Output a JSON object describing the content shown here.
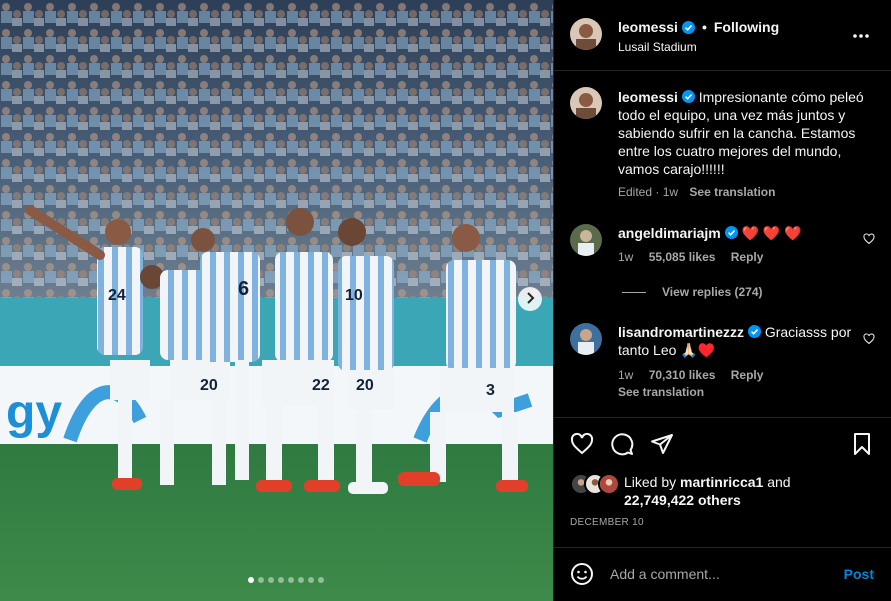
{
  "post": {
    "author": "leomessi",
    "follow_state": "Following",
    "separator": "•",
    "location": "Lusail Stadium",
    "more_icon": "more-horizontal-icon",
    "date": "DECEMBER 10"
  },
  "caption": {
    "username": "leomessi",
    "text": "Impresionante cómo peleó todo el equipo, una vez más juntos y sabiendo sufrir en la cancha. Estamos entre los cuatro mejores del mundo, vamos carajo!!!!!!",
    "edited": "Edited",
    "dot": "·",
    "age": "1w",
    "see_translation": "See translation"
  },
  "comments": [
    {
      "username": "angeldimariajm",
      "text": "❤️ ❤️ ❤️",
      "age": "1w",
      "likes": "55,085 likes",
      "reply": "Reply",
      "view_replies": "View replies (274)"
    },
    {
      "username": "lisandromartinezzz",
      "text": "Graciasss por tanto Leo 🙏🏻♥️",
      "age": "1w",
      "likes": "70,310 likes",
      "reply": "Reply",
      "see_translation": "See translation"
    }
  ],
  "likes": {
    "prefix": "Liked by",
    "user": "martinricca1",
    "and": "and",
    "others": "22,749,422 others"
  },
  "comment_box": {
    "placeholder": "Add a comment...",
    "post_label": "Post"
  },
  "carousel": {
    "slides": 8,
    "active_index": 0
  },
  "photo": {
    "jersey_numbers": [
      "24",
      "20",
      "6",
      "22",
      "10",
      "20",
      "3"
    ],
    "ad_text": "gy"
  },
  "colors": {
    "accent": "#0095f6",
    "verified": "#0095f6",
    "secondary_text": "#a8a8a8",
    "divider": "#262626"
  },
  "icons": [
    "verified-badge-icon",
    "heart-icon",
    "comment-icon",
    "share-icon",
    "bookmark-icon",
    "emoji-icon",
    "chevron-right-icon"
  ]
}
